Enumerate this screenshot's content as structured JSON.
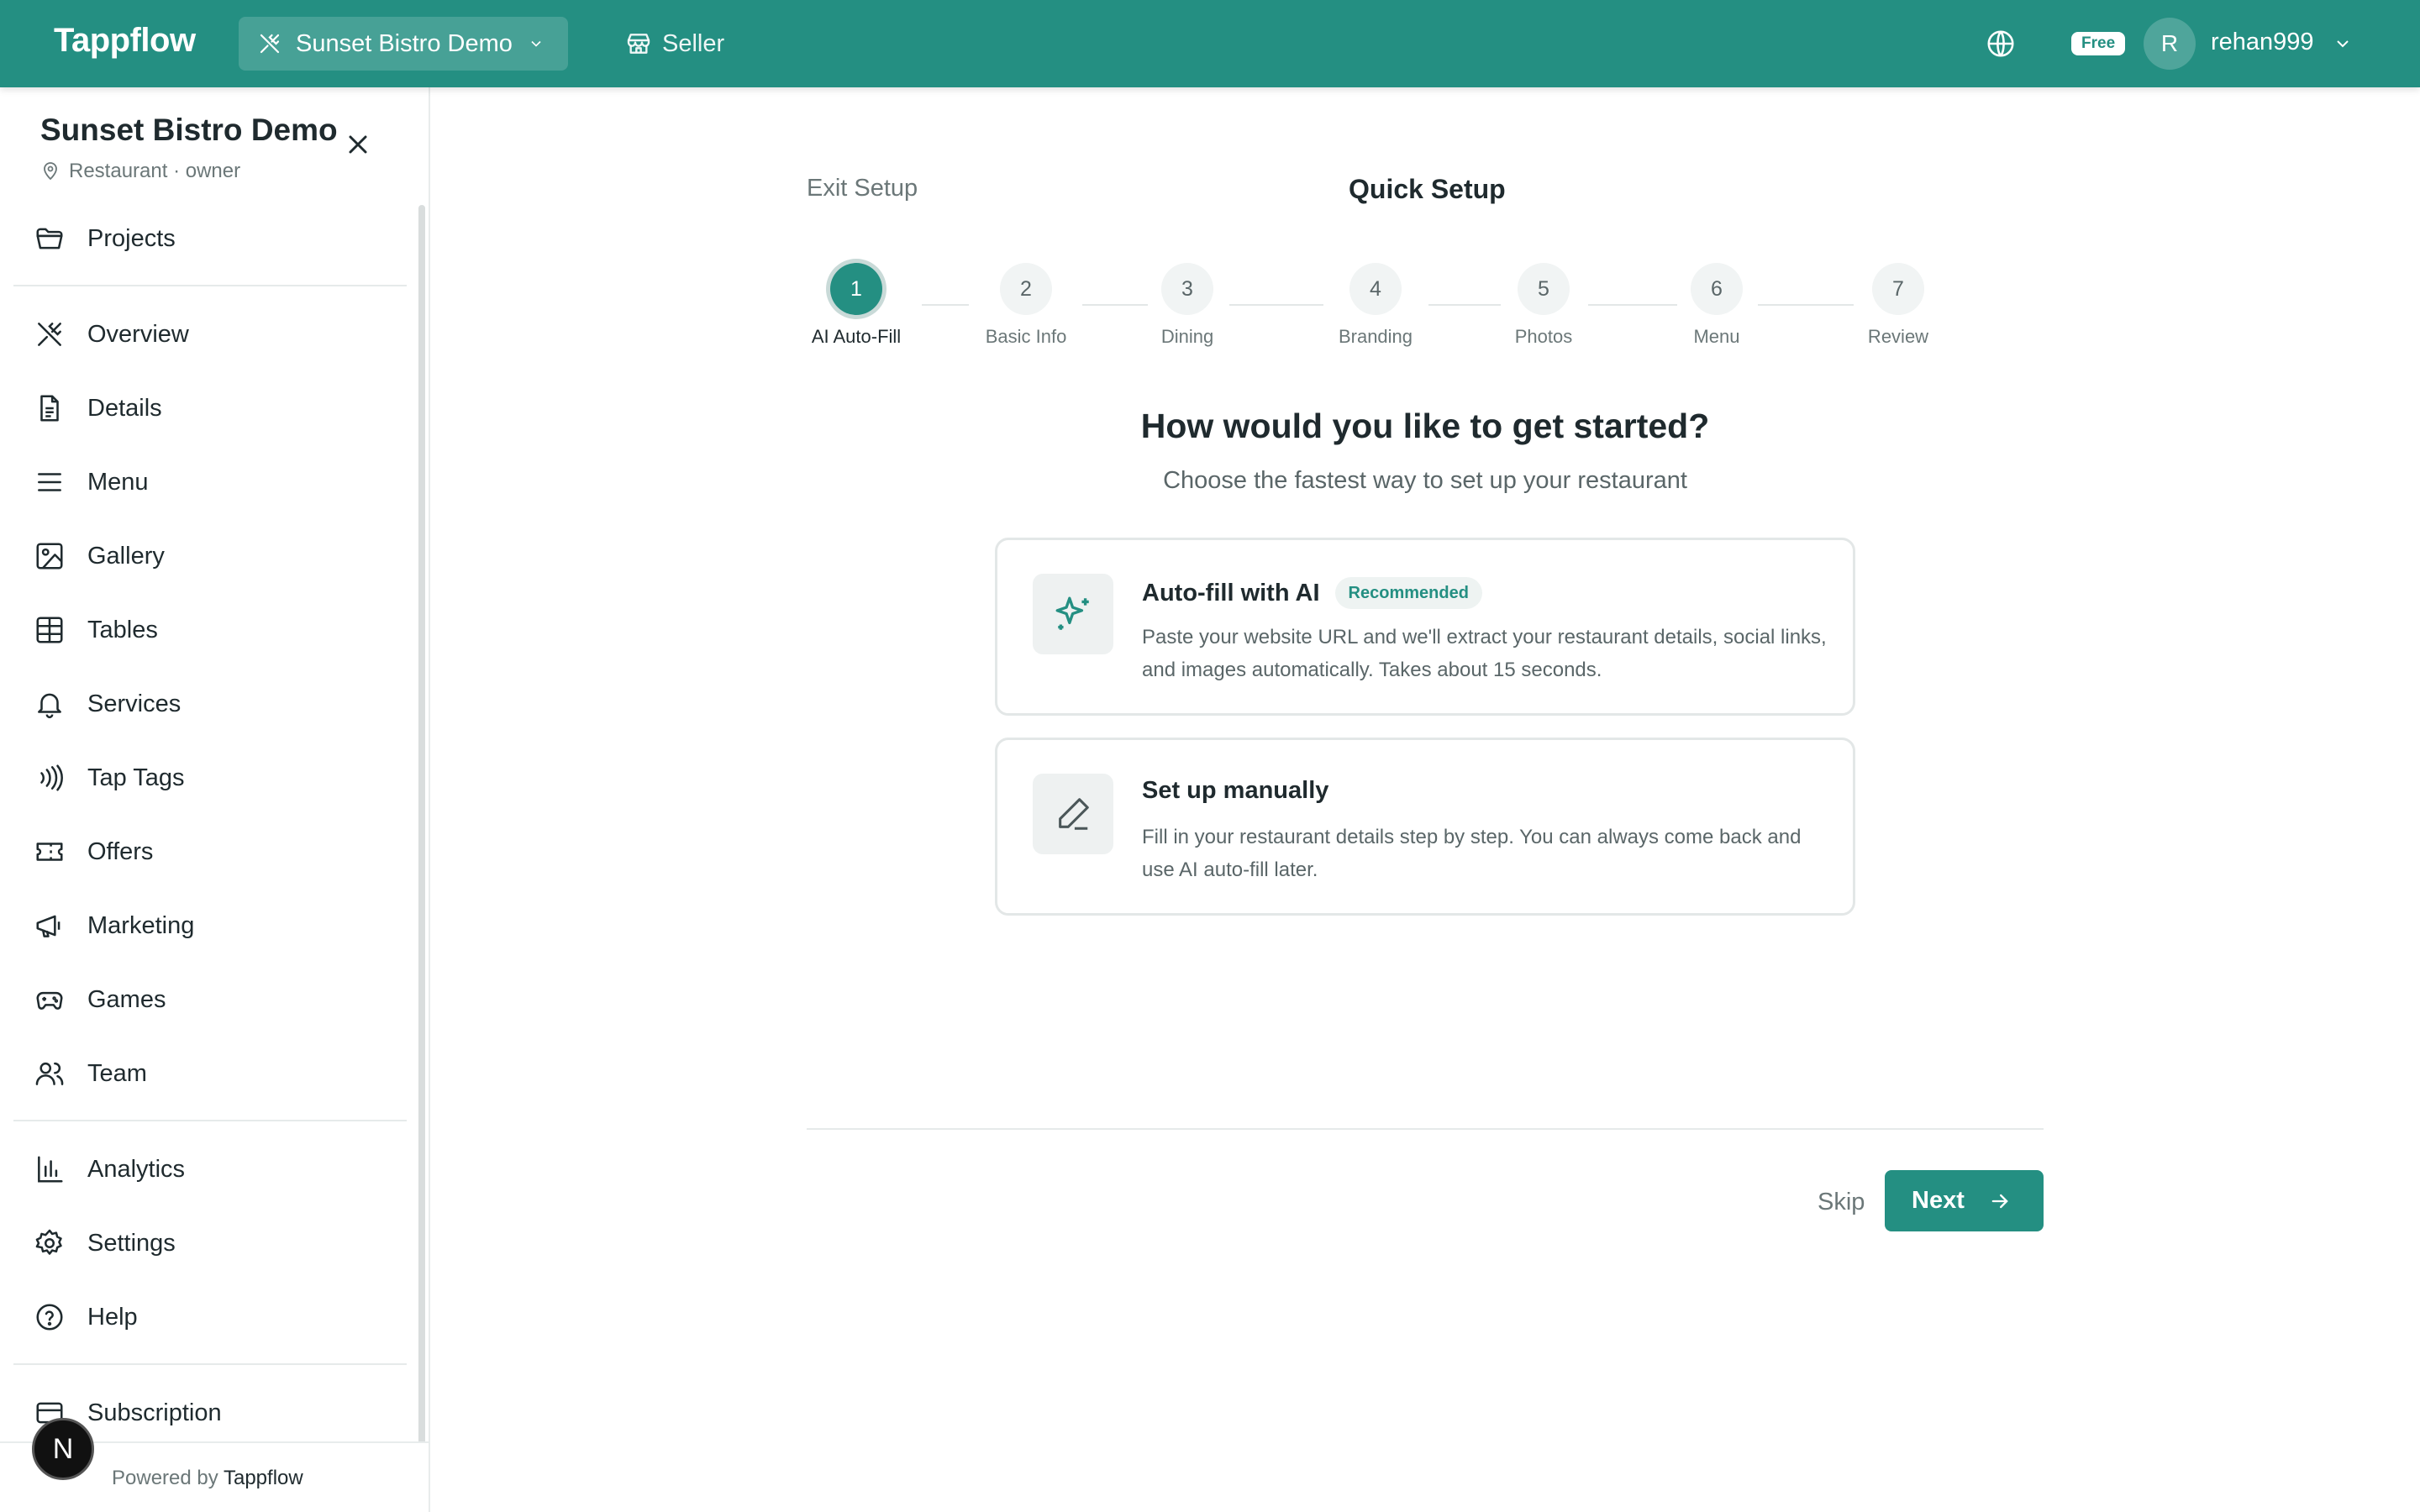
{
  "topbar": {
    "logo": "Tappflow",
    "venue": "Sunset Bistro Demo",
    "seller": "Seller",
    "plan_badge": "Free",
    "avatar_initial": "R",
    "username": "rehan999",
    "brand_color": "#248f82"
  },
  "sidebar": {
    "title": "Sunset Bistro Demo",
    "subtitle": "Restaurant · owner",
    "items": [
      {
        "label": "Projects",
        "icon": "folder-icon"
      },
      {
        "label": "Overview",
        "icon": "utensils-icon"
      },
      {
        "label": "Details",
        "icon": "document-icon"
      },
      {
        "label": "Menu",
        "icon": "list-icon"
      },
      {
        "label": "Gallery",
        "icon": "image-icon"
      },
      {
        "label": "Tables",
        "icon": "grid-icon"
      },
      {
        "label": "Services",
        "icon": "bell-icon"
      },
      {
        "label": "Tap Tags",
        "icon": "nfc-icon"
      },
      {
        "label": "Offers",
        "icon": "ticket-icon"
      },
      {
        "label": "Marketing",
        "icon": "megaphone-icon"
      },
      {
        "label": "Games",
        "icon": "gamepad-icon"
      },
      {
        "label": "Team",
        "icon": "users-icon"
      },
      {
        "label": "Analytics",
        "icon": "bar-chart-icon"
      },
      {
        "label": "Settings",
        "icon": "gear-icon"
      },
      {
        "label": "Help",
        "icon": "help-circle-icon"
      },
      {
        "label": "Subscription",
        "icon": "credit-card-icon"
      }
    ],
    "powered_prefix": "Powered by",
    "powered_brand": "Tappflow",
    "dev_badge": "N"
  },
  "setup": {
    "exit_label": "Exit Setup",
    "title": "Quick Setup",
    "current_step": 1,
    "steps": [
      {
        "number": "1",
        "label": "AI Auto-Fill"
      },
      {
        "number": "2",
        "label": "Basic Info"
      },
      {
        "number": "3",
        "label": "Dining"
      },
      {
        "number": "4",
        "label": "Branding"
      },
      {
        "number": "5",
        "label": "Photos"
      },
      {
        "number": "6",
        "label": "Menu"
      },
      {
        "number": "7",
        "label": "Review"
      }
    ],
    "heading": "How would you like to get started?",
    "subheading": "Choose the fastest way to set up your restaurant",
    "options": [
      {
        "title": "Auto-fill with AI",
        "badge": "Recommended",
        "description": "Paste your website URL and we'll extract your restaurant details, social links, and images automatically. Takes about 15 seconds.",
        "icon": "sparkles-icon"
      },
      {
        "title": "Set up manually",
        "description": "Fill in your restaurant details step by step. You can always come back and use AI auto-fill later.",
        "icon": "pencil-icon"
      }
    ],
    "skip_label": "Skip",
    "next_label": "Next"
  }
}
